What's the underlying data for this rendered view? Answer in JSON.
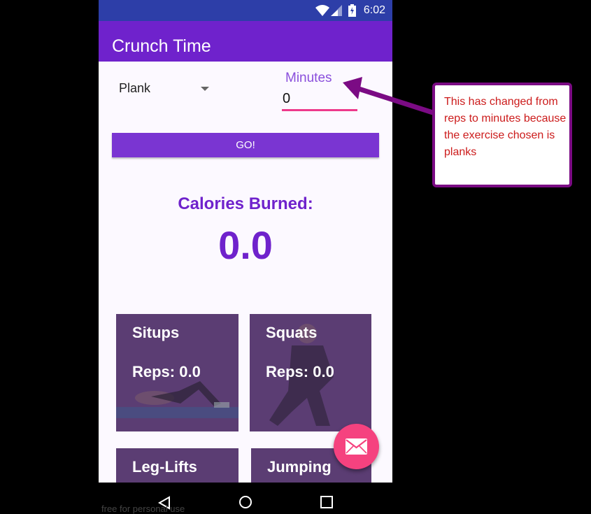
{
  "status_bar": {
    "time": "6:02"
  },
  "app_bar": {
    "title": "Crunch Time"
  },
  "exercise_spinner": {
    "selected": "Plank"
  },
  "amount_field": {
    "label": "Minutes",
    "value": "0"
  },
  "go_button": {
    "label": "GO!"
  },
  "calories": {
    "label": "Calories Burned:",
    "value": "0.0"
  },
  "cards": [
    {
      "name": "Situps",
      "reps": "Reps: 0.0"
    },
    {
      "name": "Squats",
      "reps": "Reps: 0.0"
    },
    {
      "name": "Leg-Lifts"
    },
    {
      "name": "Jumping"
    }
  ],
  "callout": {
    "text": "This has changed from reps to minutes because the exercise chosen is planks"
  },
  "watermark": {
    "text": "free for personal use"
  },
  "colors": {
    "primary": "#6f22cc",
    "status": "#2d3ea8",
    "accent": "#f5427f",
    "callout_border": "#7b0b84",
    "callout_text": "#cc1b1b"
  },
  "icons": [
    "wifi-icon",
    "signal-icon",
    "battery-icon",
    "mail-icon",
    "back-icon",
    "home-icon",
    "recents-icon",
    "dropdown-arrow-icon"
  ]
}
